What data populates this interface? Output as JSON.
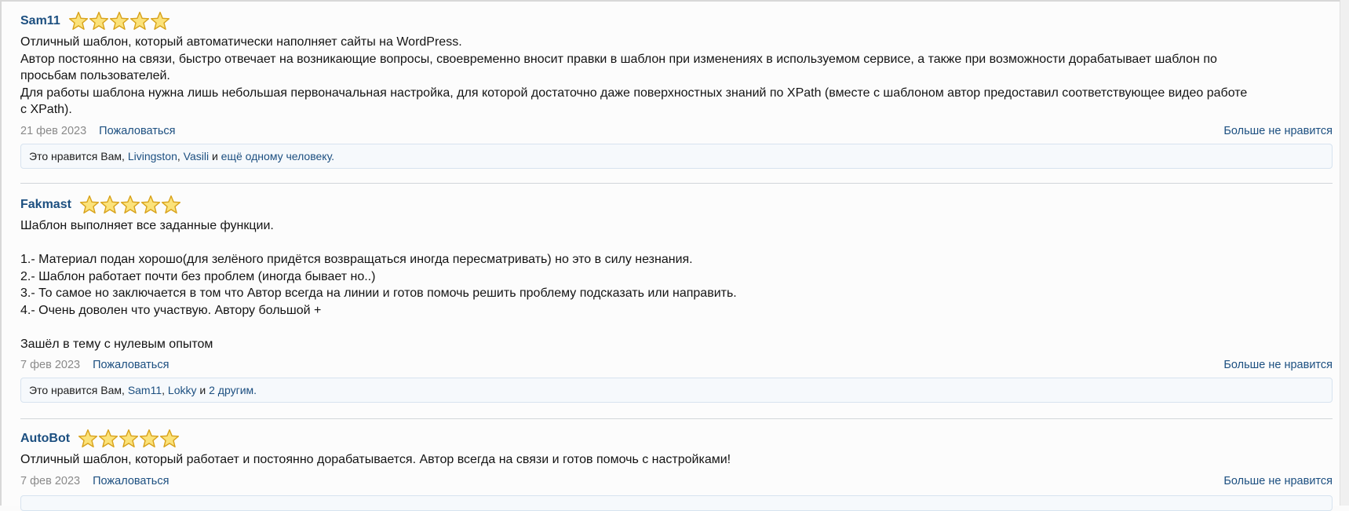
{
  "reviews": [
    {
      "author": "Sam11",
      "rating": 5,
      "lines": [
        "Отличный шаблон, который автоматически наполняет сайты на WordPress.",
        "Автор постоянно на связи, быстро отвечает на возникающие вопросы, своевременно вносит правки в шаблон при изменениях в используемом сервисе, а также при возможности дорабатывает шаблон по",
        "просьбам пользователей.",
        "Для работы шаблона нужна лишь небольшая первоначальная настройка, для которой достаточно даже поверхностных знаний по XPath (вместе с шаблоном автор предоставил соответствующее видео работе",
        "с XPath)."
      ],
      "date": "21 фев 2023",
      "report": "Пожаловаться",
      "unlike": "Больше не нравится",
      "likes": {
        "prefix": "Это нравится Вам,",
        "users": [
          "Livingston",
          "Vasili"
        ],
        "connector": "и",
        "others": "ещё одному человеку."
      }
    },
    {
      "author": "Fakmast",
      "rating": 5,
      "lines": [
        "Шаблон выполняет все заданные функции.",
        "",
        "1.- Материал подан хорошо(для зелёного придётся возвращаться иногда пересматривать) но это в силу незнания.",
        "2.- Шаблон работает почти без проблем (иногда бывает но..)",
        "3.- То самое но заключается в том что Автор всегда на линии и готов помочь решить проблему подсказать или направить.",
        "4.- Очень доволен что участвую. Автору большой +",
        "",
        "Зашёл в тему с нулевым опытом"
      ],
      "date": "7 фев 2023",
      "report": "Пожаловаться",
      "unlike": "Больше не нравится",
      "likes": {
        "prefix": "Это нравится Вам,",
        "users": [
          "Sam11",
          "Lokky"
        ],
        "connector": "и",
        "others": "2 другим."
      }
    },
    {
      "author": "AutoBot",
      "rating": 5,
      "lines": [
        "Отличный шаблон, который работает и постоянно дорабатывается. Автор всегда на связи и готов помочь с настройками!"
      ],
      "date": "7 фев 2023",
      "report": "Пожаловаться",
      "unlike": "Больше не нравится"
    }
  ],
  "colors": {
    "link": "#1c4f80",
    "star_fill": "#fbe27a",
    "star_stroke": "#d8a21b"
  },
  "icons": {
    "star": "star-icon"
  }
}
